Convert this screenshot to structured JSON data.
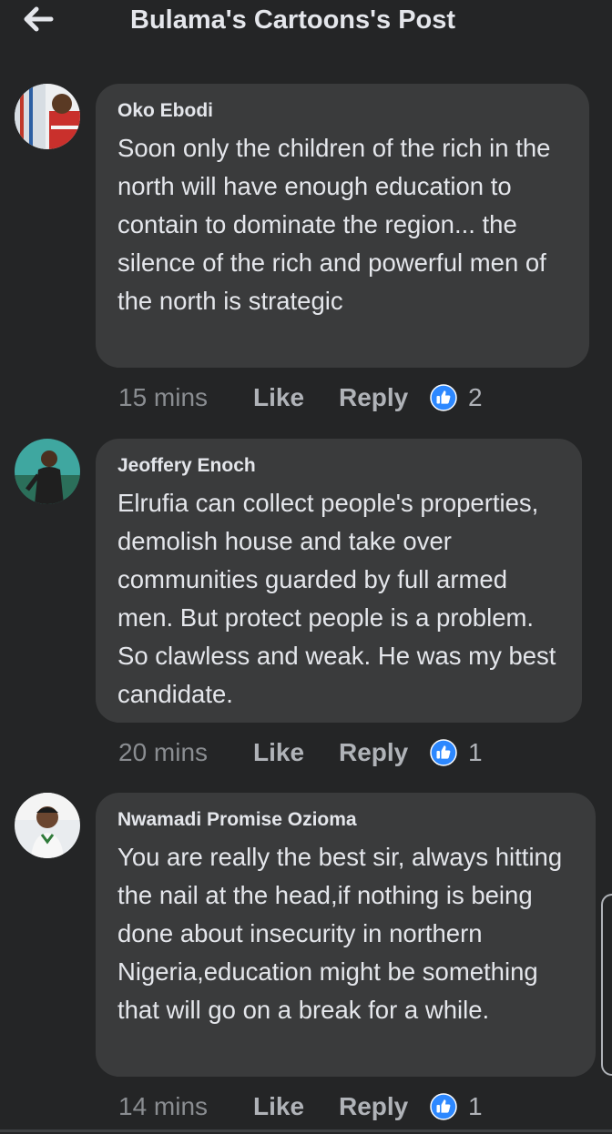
{
  "header": {
    "title": "Bulama's Cartoons's Post",
    "back_icon": "back-arrow-icon"
  },
  "comments": [
    {
      "author": "Oko Ebodi",
      "text": "Soon only the children of the rich in the north will have enough education to contain to dominate the region... the silence of the rich and powerful men of the north is strategic",
      "time": "15 mins",
      "like_label": "Like",
      "reply_label": "Reply",
      "reaction_icon": "thumbs-up-icon",
      "reaction_count": "2"
    },
    {
      "author": "Jeoffery Enoch",
      "text": "Elrufia can collect people's properties, demolish house and take over communities guarded by full armed men. But protect people is a problem. So clawless and weak. He was my best candidate.",
      "time": "20 mins",
      "like_label": "Like",
      "reply_label": "Reply",
      "reaction_icon": "thumbs-up-icon",
      "reaction_count": "1"
    },
    {
      "author": "Nwamadi Promise Ozioma",
      "text": "You are really the best sir, always hitting the nail at the head,if nothing is being done  about insecurity in northern Nigeria,education might be something that will go on a break for a while.",
      "time": "14 mins",
      "like_label": "Like",
      "reply_label": "Reply",
      "reaction_icon": "thumbs-up-icon",
      "reaction_count": "1"
    }
  ],
  "colors": {
    "background": "#242526",
    "bubble": "#3a3b3c",
    "text": "#e4e6eb",
    "muted": "#b0b3b8",
    "like_blue": "#2d88ff"
  }
}
